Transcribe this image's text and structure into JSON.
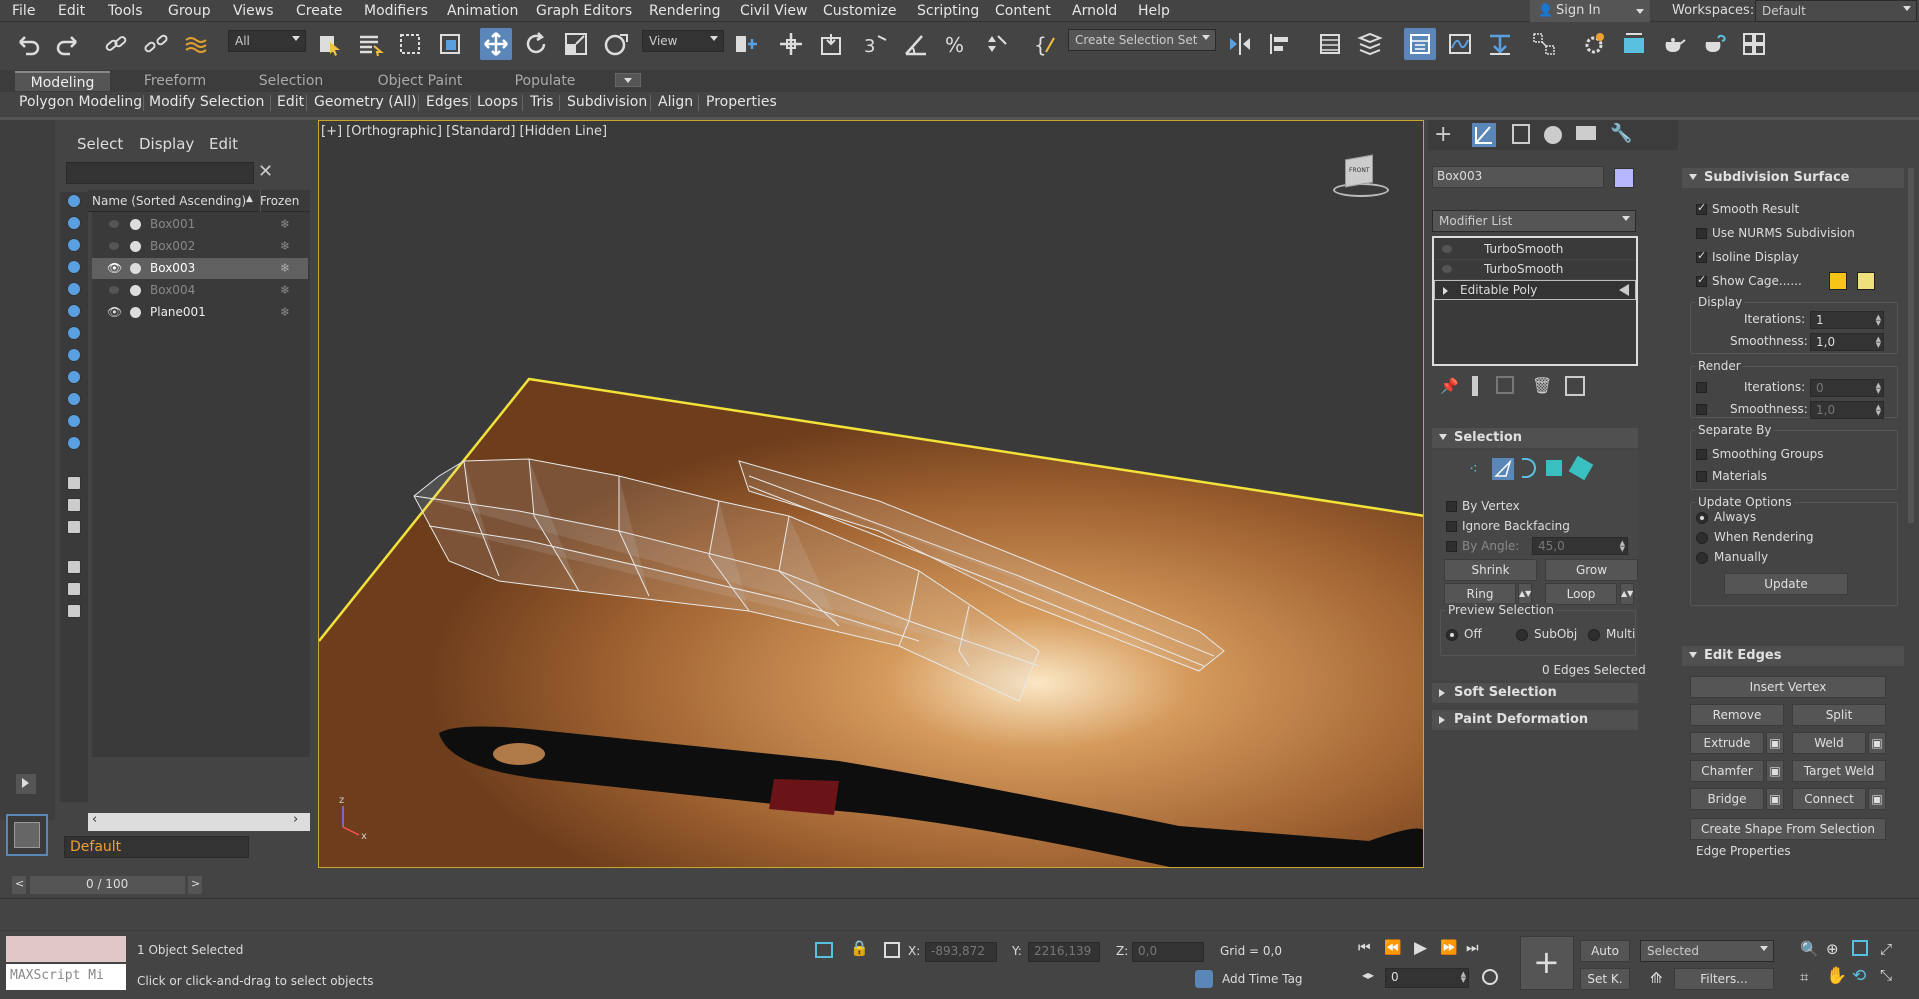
{
  "menu": [
    "File",
    "Edit",
    "Tools",
    "Group",
    "Views",
    "Create",
    "Modifiers",
    "Animation",
    "Graph Editors",
    "Rendering",
    "Civil View",
    "Customize",
    "Scripting",
    "Content",
    "Arnold",
    "Help"
  ],
  "account": {
    "signin": "Sign In",
    "workspaces_label": "Workspaces:",
    "workspace": "Default"
  },
  "toolbar": {
    "filter": "All",
    "refcoord": "View",
    "selset": "Create Selection Set"
  },
  "ribbon": {
    "tabs": [
      "Modeling",
      "Freeform",
      "Selection",
      "Object Paint",
      "Populate"
    ],
    "row": [
      "Polygon Modeling",
      "Modify Selection",
      "Edit",
      "Geometry (All)",
      "Edges",
      "Loops",
      "Tris",
      "Subdivision",
      "Align",
      "Properties"
    ]
  },
  "explorer": {
    "tabs": [
      "Select",
      "Display",
      "Edit"
    ],
    "col_name": "Name (Sorted Ascending)",
    "col_frozen": "Frozen",
    "items": [
      "Box001",
      "Box002",
      "Box003",
      "Box004",
      "Plane001"
    ],
    "layer": "Default"
  },
  "viewport": {
    "label": "[+] [Orthographic] [Standard] [Hidden Line]",
    "cube": "FRONT"
  },
  "command": {
    "object_name": "Box003",
    "modlist": "Modifier List",
    "stack": [
      "TurboSmooth",
      "TurboSmooth",
      "Editable Poly"
    ],
    "selection": {
      "title": "Selection",
      "by_vertex": "By Vertex",
      "ignore_backfacing": "Ignore Backfacing",
      "by_angle": "By Angle:",
      "angle": "45,0",
      "shrink": "Shrink",
      "grow": "Grow",
      "ring": "Ring",
      "loop": "Loop",
      "preview": "Preview Selection",
      "off": "Off",
      "subobj": "SubObj",
      "multi": "Multi",
      "status": "0 Edges Selected"
    },
    "soft": "Soft Selection",
    "paint": "Paint Deformation"
  },
  "subdiv": {
    "title": "Subdivision Surface",
    "smooth": "Smooth Result",
    "nurms": "Use NURMS Subdivision",
    "isoline": "Isoline Display",
    "cage": "Show Cage......",
    "display": "Display",
    "iter_lbl": "Iterations:",
    "iter": "1",
    "smooth_lbl": "Smoothness:",
    "smoothv": "1,0",
    "render": "Render",
    "r_iter": "0",
    "r_smooth": "1,0",
    "separate": "Separate By",
    "sg": "Smoothing Groups",
    "materials": "Materials",
    "update_opts": "Update Options",
    "always": "Always",
    "when_rendering": "When Rendering",
    "manually": "Manually",
    "update": "Update",
    "cage_colors": [
      "#f5c518",
      "#efe07a"
    ]
  },
  "edit_edges": {
    "title": "Edit Edges",
    "insert_vertex": "Insert Vertex",
    "remove": "Remove",
    "split": "Split",
    "extrude": "Extrude",
    "weld": "Weld",
    "chamfer": "Chamfer",
    "target_weld": "Target Weld",
    "bridge": "Bridge",
    "connect": "Connect",
    "create_shape": "Create Shape From Selection",
    "edge_props": "Edge Properties"
  },
  "timeline": {
    "frame": "0 / 100"
  },
  "status": {
    "selected": "1 Object Selected",
    "prompt": "Click or click-and-drag to select objects",
    "maxscript": "MAXScript Mi",
    "x_lbl": "X:",
    "x": "-893,872",
    "y_lbl": "Y:",
    "y": "2216,139",
    "z_lbl": "Z:",
    "z": "0,0",
    "grid": "Grid = 0,0",
    "time_tag": "Add Time Tag",
    "auto": "Auto",
    "setk": "Set K.",
    "selected_dd": "Selected",
    "filters": "Filters...",
    "frame_field": "0"
  }
}
